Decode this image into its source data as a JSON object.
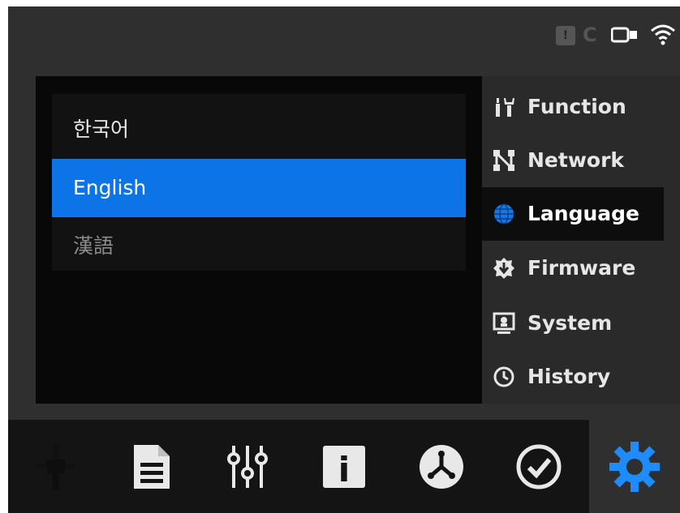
{
  "status_bar": {
    "icons": [
      "warning-icon",
      "sync-icon",
      "camera-icon",
      "wifi-icon"
    ],
    "warning_glyph": "!"
  },
  "languages": {
    "items": [
      {
        "label": "한국어",
        "selected": false
      },
      {
        "label": "English",
        "selected": true
      },
      {
        "label": "漢語",
        "selected": false
      }
    ]
  },
  "menu": {
    "items": [
      {
        "label": "Function",
        "icon": "tools-icon",
        "active": false
      },
      {
        "label": "Network",
        "icon": "network-icon",
        "active": false
      },
      {
        "label": "Language",
        "icon": "globe-icon",
        "active": true
      },
      {
        "label": "Firmware",
        "icon": "firmware-icon",
        "active": false
      },
      {
        "label": "System",
        "icon": "system-icon",
        "active": false
      },
      {
        "label": "History",
        "icon": "history-icon",
        "active": false
      }
    ]
  },
  "tab_bar": {
    "tabs": [
      {
        "icon": "move-axes-icon",
        "active": false
      },
      {
        "icon": "file-icon",
        "active": false
      },
      {
        "icon": "sliders-icon",
        "active": false
      },
      {
        "icon": "info-icon",
        "active": false
      },
      {
        "icon": "network-hub-icon",
        "active": false
      },
      {
        "icon": "check-circle-icon",
        "active": false
      },
      {
        "icon": "settings-gear-icon",
        "active": true
      }
    ],
    "info_glyph": "i"
  },
  "colors": {
    "accent": "#0d74e8",
    "background": "#2f2f2f",
    "panel": "#080808",
    "menu_active_bg": "#0d0d0d"
  }
}
